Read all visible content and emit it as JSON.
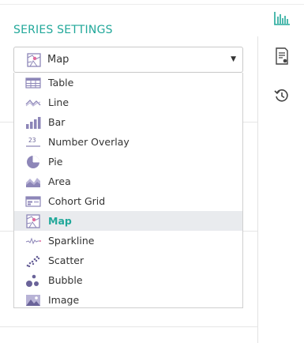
{
  "section_title": "SERIES SETTINGS",
  "select": {
    "value": "Map"
  },
  "menu_items": [
    {
      "label": "Table",
      "icon": "table-icon"
    },
    {
      "label": "Line",
      "icon": "line-icon"
    },
    {
      "label": "Bar",
      "icon": "bar-icon"
    },
    {
      "label": "Number Overlay",
      "icon": "number-overlay-icon"
    },
    {
      "label": "Pie",
      "icon": "pie-icon"
    },
    {
      "label": "Area",
      "icon": "area-icon"
    },
    {
      "label": "Cohort Grid",
      "icon": "cohort-grid-icon"
    },
    {
      "label": "Map",
      "icon": "map-icon",
      "selected": true
    },
    {
      "label": "Sparkline",
      "icon": "sparkline-icon"
    },
    {
      "label": "Scatter",
      "icon": "scatter-icon"
    },
    {
      "label": "Bubble",
      "icon": "bubble-icon"
    },
    {
      "label": "Image",
      "icon": "image-icon"
    }
  ],
  "number_overlay_glyph": "23",
  "sidebar": [
    "chart-settings-icon",
    "document-settings-icon",
    "history-icon"
  ],
  "colors": {
    "accent": "#22a89a",
    "icon_purple": "#8d86b8",
    "selected_bg": "#e9ebee"
  }
}
